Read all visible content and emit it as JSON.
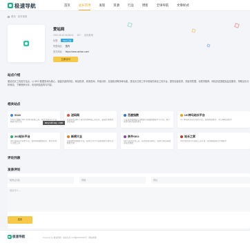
{
  "header": {
    "logo_text": "极速导航",
    "nav": [
      "首页",
      "站长常用",
      "发现",
      "资源",
      "行业",
      "博客",
      "全球导航",
      "文章样式"
    ],
    "active_index": 1
  },
  "breadcrumb": "首页 · 站长常用",
  "site": {
    "name": "爱站网",
    "date": "2022-05-19 06:28:01",
    "views": "327",
    "category": "站长常用",
    "tag_label": "标签:",
    "tag": "SEO工具",
    "origin_label": "所属地区:",
    "origin": "国内",
    "url_label": "官方网址:",
    "url": "https://www.aizhan.com/",
    "visit_label": "立即访问"
  },
  "intro": {
    "title": "站点介绍",
    "text": "爱站站长工具官方站点，以 SEO 数据查询为核心，涵盖关键词排名、网站权重、收录查询、外链分析、友链检测等多种功能，是站长日常工作中常用的综合工具平台。提供百度权重、关键词挖掘、长尾词推荐、网站历史数据及监控服务，帮助站长分析网站、了解竞争对手、优化网站结构与内容。"
  },
  "related": {
    "title": "相关站点",
    "items": [
      {
        "name": "5118",
        "desc": "5118 大数据 SEO 关键词挖掘工具，站长长尾词与行业数据分析平台",
        "color": "#3c82f6"
      },
      {
        "name": "送码网",
        "desc": "提供站长源码下载与各类网站工具信息，是站长常用的资源站点",
        "color": "#e74c3c"
      },
      {
        "name": "百度指数",
        "desc": "以百度海量网民行为数据为基础的数据分享平台，用于关键词搜索趋势研究",
        "color": "#2f6fde"
      },
      {
        "name": "UC神马站长平台",
        "desc": "UC 神马搜索官方站长平台，提供网站收录、索引等相关服务",
        "color": "#f39c12"
      },
      {
        "name": "360站长平台",
        "desc": "360 搜索官方站长平台，提供网站数据提交、收录查询与诊断工具",
        "color": "#27ae60"
      },
      {
        "name": "新榜大全",
        "desc": "新媒体内容数据平台，提供公众号与短视频账号排行及数据分析",
        "color": "#e67e22"
      },
      {
        "name": "奈齐SEO",
        "desc": "SEO 综合查询工具，提供关键词排名、权重与收录等常用站长数据",
        "color": "#8e44ad"
      },
      {
        "name": "站长之家",
        "desc": "中文站长资讯与建站工具平台，提供网站综合查询服务",
        "color": "#c0392b"
      }
    ]
  },
  "watermark": "moyublog.com",
  "comments": {
    "list_title": "评论列表",
    "form_title": "发表评论",
    "name_placeholder": "昵称(必填)",
    "email_placeholder": "邮箱",
    "site_placeholder": "网址",
    "content_placeholder": "说点什么...",
    "submit_label": "发布"
  },
  "footer": {
    "logo_text": "极速导航",
    "copyright": "Powered by 极速导航 · 备案信息 ICP备00000000号 · 网站地图"
  }
}
